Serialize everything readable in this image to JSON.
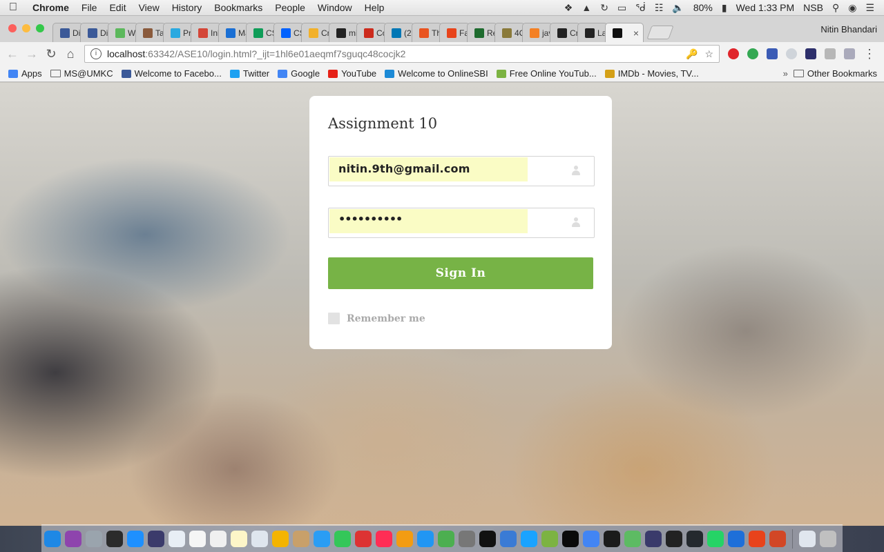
{
  "menubar": {
    "app_name": "Chrome",
    "items": [
      "File",
      "Edit",
      "View",
      "History",
      "Bookmarks",
      "People",
      "Window",
      "Help"
    ],
    "battery": "80%",
    "clock": "Wed 1:33 PM",
    "user_initials": "NSB"
  },
  "browser": {
    "profile_name": "Nitin Bhandari",
    "tabs": [
      {
        "title": "Di",
        "icon": "facebook-icon",
        "color": "#3b5998"
      },
      {
        "title": "Di",
        "icon": "facebook-icon",
        "color": "#3b5998"
      },
      {
        "title": "W",
        "icon": "w-icon",
        "color": "#5cb85c"
      },
      {
        "title": "Ta",
        "icon": "cc-icon",
        "color": "#8a5a3c"
      },
      {
        "title": "Pr",
        "icon": "u-icon",
        "color": "#2aa9e0"
      },
      {
        "title": "Inl",
        "icon": "gmail-icon",
        "color": "#d44638"
      },
      {
        "title": "Ma",
        "icon": "mail-icon",
        "color": "#1a6fd4"
      },
      {
        "title": "CS",
        "icon": "sheets-icon",
        "color": "#0f9d58"
      },
      {
        "title": "CS",
        "icon": "dropbox-icon",
        "color": "#0061fe"
      },
      {
        "title": "Cr",
        "icon": "box-icon",
        "color": "#f2b12b"
      },
      {
        "title": "mi",
        "icon": "mi-icon",
        "color": "#222"
      },
      {
        "title": "Co",
        "icon": "opera-icon",
        "color": "#cc2b1d"
      },
      {
        "title": "(2",
        "icon": "linkedin-icon",
        "color": "#0077b5"
      },
      {
        "title": "Th",
        "icon": "s-icon",
        "color": "#e95420"
      },
      {
        "title": "Fa",
        "icon": "percent-icon",
        "color": "#e8441b"
      },
      {
        "title": "Re",
        "icon": "leaf-icon",
        "color": "#1e6b2e"
      },
      {
        "title": "4C",
        "icon": "ths-icon",
        "color": "#8a7a3a"
      },
      {
        "title": "jav",
        "icon": "stack-icon",
        "color": "#f48024"
      },
      {
        "title": "Cr",
        "icon": "github-icon",
        "color": "#222"
      },
      {
        "title": "La",
        "icon": "github-icon",
        "color": "#222"
      },
      {
        "title": "",
        "icon": "ws-icon",
        "color": "#111",
        "active": true
      }
    ],
    "url_host": "localhost",
    "url_path": ":63342/ASE10/login.html?_ijt=1hl6e01aeqmf7sguqc48cocjk2",
    "bookmarks": [
      {
        "label": "Apps",
        "icon": "apps-icon",
        "color": "#4285f4"
      },
      {
        "label": "MS@UMKC",
        "icon": "folder-icon",
        "color": "#777"
      },
      {
        "label": "Welcome to Facebo...",
        "icon": "facebook-icon",
        "color": "#3b5998"
      },
      {
        "label": "Twitter",
        "icon": "twitter-icon",
        "color": "#1da1f2"
      },
      {
        "label": "Google",
        "icon": "google-icon",
        "color": "#4285f4"
      },
      {
        "label": "YouTube",
        "icon": "youtube-icon",
        "color": "#e62117"
      },
      {
        "label": "Welcome to OnlineSBI",
        "icon": "sbi-icon",
        "color": "#1c8ad6"
      },
      {
        "label": "Free Online YouTub...",
        "icon": "download-icon",
        "color": "#7cb342"
      },
      {
        "label": "IMDb - Movies, TV...",
        "icon": "imdb-icon",
        "color": "#d4a017"
      }
    ],
    "other_bookmarks": "Other Bookmarks"
  },
  "login": {
    "title": "Assignment 10",
    "email_value": "nitin.9th@gmail.com",
    "password_value": "••••••••••",
    "signin_label": "Sign In",
    "remember_label": "Remember me"
  },
  "colors": {
    "signin_button": "#77b346",
    "autofill": "#fafcc5"
  }
}
